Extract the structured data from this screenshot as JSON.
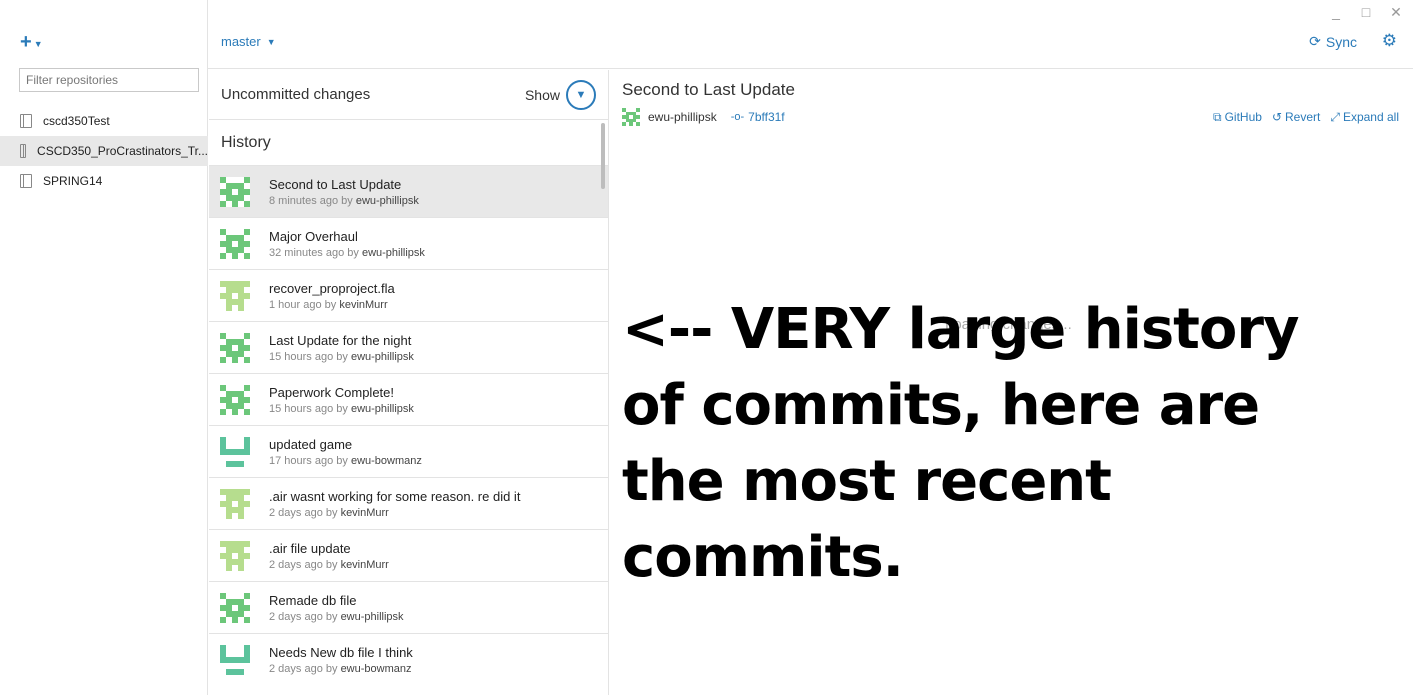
{
  "window": {
    "minimize": "_",
    "maximize": "□",
    "close": "✕"
  },
  "sidebar": {
    "add_icon": "plus-icon",
    "filter_placeholder": "Filter repositories",
    "repos": [
      {
        "name": "cscd350Test",
        "active": false
      },
      {
        "name": "CSCD350_ProCrastinators_Tr...",
        "active": true
      },
      {
        "name": "SPRING14",
        "active": false
      }
    ]
  },
  "header": {
    "branch": "master",
    "sync_label": "Sync"
  },
  "history": {
    "uncommitted_label": "Uncommitted changes",
    "show_label": "Show",
    "title": "History",
    "commits": [
      {
        "title": "Second to Last Update",
        "when": "8 minutes ago by",
        "author": "ewu-phillipsk",
        "avatar": "phillipsk",
        "active": true
      },
      {
        "title": "Major Overhaul",
        "when": "32 minutes ago by",
        "author": "ewu-phillipsk",
        "avatar": "phillipsk",
        "active": false
      },
      {
        "title": "recover_proproject.fla",
        "when": "1 hour ago by",
        "author": "kevinMurr",
        "avatar": "kevin",
        "active": false
      },
      {
        "title": "Last Update for the night",
        "when": "15 hours ago by",
        "author": "ewu-phillipsk",
        "avatar": "phillipsk",
        "active": false
      },
      {
        "title": "Paperwork Complete!",
        "when": "15 hours ago by",
        "author": "ewu-phillipsk",
        "avatar": "phillipsk",
        "active": false
      },
      {
        "title": "updated game",
        "when": "17 hours ago by",
        "author": "ewu-bowmanz",
        "avatar": "bowmanz",
        "active": false
      },
      {
        "title": ".air wasnt working for some reason. re did it",
        "when": "2 days ago by",
        "author": "kevinMurr",
        "avatar": "kevin",
        "active": false
      },
      {
        "title": ".air file update",
        "when": "2 days ago by",
        "author": "kevinMurr",
        "avatar": "kevin",
        "active": false
      },
      {
        "title": "Remade db file",
        "when": "2 days ago by",
        "author": "ewu-phillipsk",
        "avatar": "phillipsk",
        "active": false
      },
      {
        "title": "Needs New db file I think",
        "when": "2 days ago by",
        "author": "ewu-bowmanz",
        "avatar": "bowmanz",
        "active": false
      }
    ]
  },
  "detail": {
    "title": "Second to Last Update",
    "author": "ewu-phillipsk",
    "sha": "7bff31f",
    "actions": {
      "github": "GitHub",
      "revert": "Revert",
      "expand": "Expand all"
    },
    "loading": "Loading changes...",
    "annotation": "<-- VERY large history of commits, here are the most recent commits."
  },
  "colors": {
    "accent": "#2b7bb9",
    "avatar_phillipsk": "#6cc77a",
    "avatar_kevin": "#b6dd8e",
    "avatar_bowmanz": "#5cc39c"
  }
}
